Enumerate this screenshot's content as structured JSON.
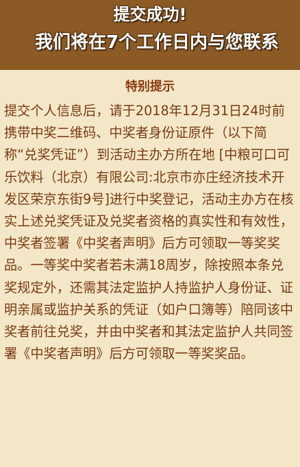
{
  "header": {
    "line1": "提交成功!",
    "line2": "我们将在7个工作日内与您联系"
  },
  "notice": {
    "title": "特别提示",
    "body": "提交个人信息后，请于2018年12月31日24时前携带中奖二维码、中奖者身份证原件（以下简称“兑奖凭证”）到活动主办方所在地 [中粮可口可乐饮料（北京）有限公司:北京市亦庄经济技术开发区荣京东街9号]进行中奖登记，活动主办方在核实上述兑奖凭证及兑奖者资格的真实性和有效性，中奖者签署《中奖者声明》后方可领取一等奖奖品。一等奖中奖者若未满18周岁，除按照本条兑奖规定外，还需其法定监护人持监护人身份证、证明亲属或监护关系的凭证（如户口簿等）陪同该中奖者前往兑奖，并由中奖者和其法定监护人共同签署《中奖者声明》后方可领取一等奖奖品。"
  },
  "colors": {
    "background": "#f4e7c8",
    "header_bg": "#8b5a25",
    "title_text": "#8b3a0f",
    "body_text": "#7a3a12"
  }
}
